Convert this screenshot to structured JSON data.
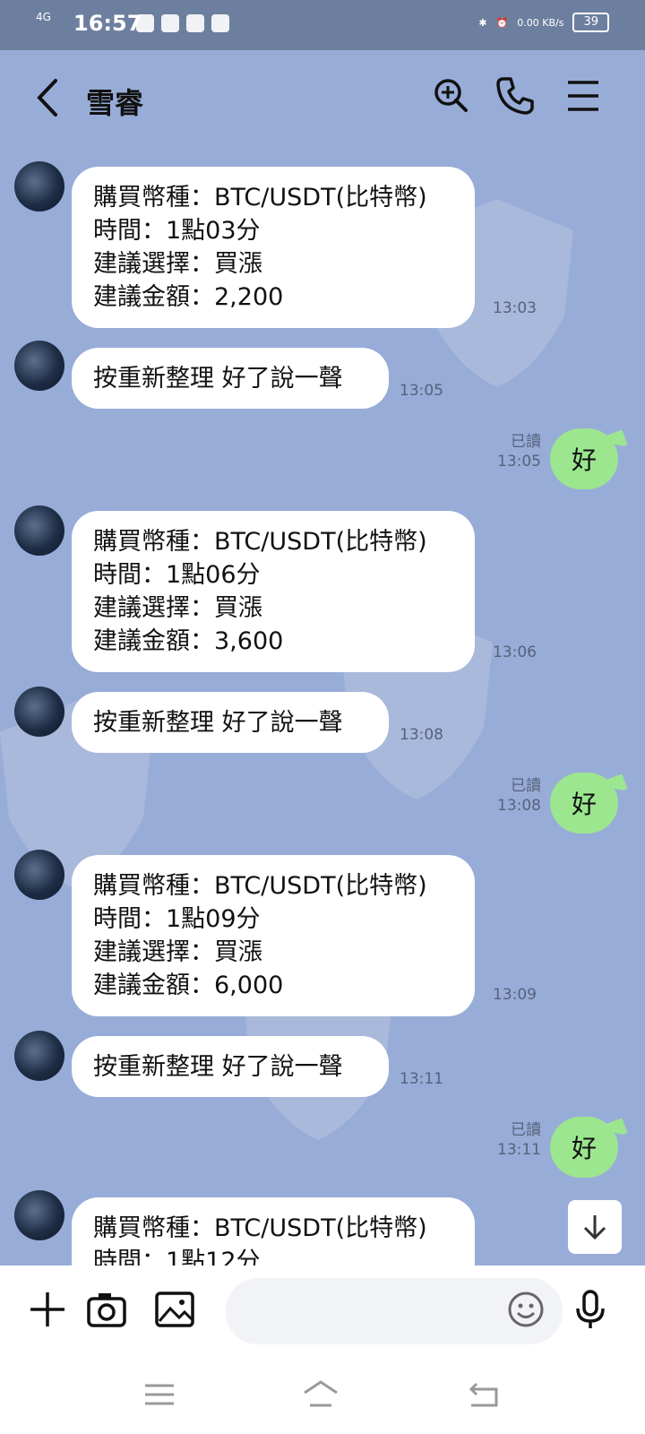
{
  "status": {
    "time": "16:57",
    "network": "4G",
    "speed": "0.00 KB/s",
    "battery": "39"
  },
  "header": {
    "title": "雪睿"
  },
  "messages": [
    {
      "lines": [
        "購買幣種：BTC/USDT(比特幣)",
        "時間：1點03分",
        "建議選擇：買漲",
        "建議金額：2,200"
      ],
      "time": "13:03"
    },
    {
      "text": "按重新整理 好了說一聲",
      "time": "13:05"
    },
    {
      "mine": "好",
      "read": "已讀",
      "time": "13:05"
    },
    {
      "lines": [
        "購買幣種：BTC/USDT(比特幣)",
        "時間：1點06分",
        "建議選擇：買漲",
        "建議金額：3,600"
      ],
      "time": "13:06"
    },
    {
      "text": "按重新整理 好了說一聲",
      "time": "13:08"
    },
    {
      "mine": "好",
      "read": "已讀",
      "time": "13:08"
    },
    {
      "lines": [
        "購買幣種：BTC/USDT(比特幣)",
        "時間：1點09分",
        "建議選擇：買漲",
        "建議金額：6,000"
      ],
      "time": "13:09"
    },
    {
      "text": "按重新整理 好了說一聲",
      "time": "13:11"
    },
    {
      "mine": "好",
      "read": "已讀",
      "time": "13:11"
    },
    {
      "lines": [
        "購買幣種：BTC/USDT(比特幣)",
        "時間：1點12分"
      ]
    }
  ],
  "input": {
    "placeholder": ""
  },
  "icons": {
    "back": "back-arrow-icon",
    "search": "search-icon",
    "call": "phone-icon",
    "menu": "menu-icon",
    "plus": "plus-icon",
    "camera": "camera-icon",
    "image": "image-icon",
    "emoji": "emoji-icon",
    "mic": "microphone-icon"
  },
  "colors": {
    "chat_background": "#98acd8",
    "own_bubble": "#9be68f",
    "other_bubble": "#ffffff"
  }
}
